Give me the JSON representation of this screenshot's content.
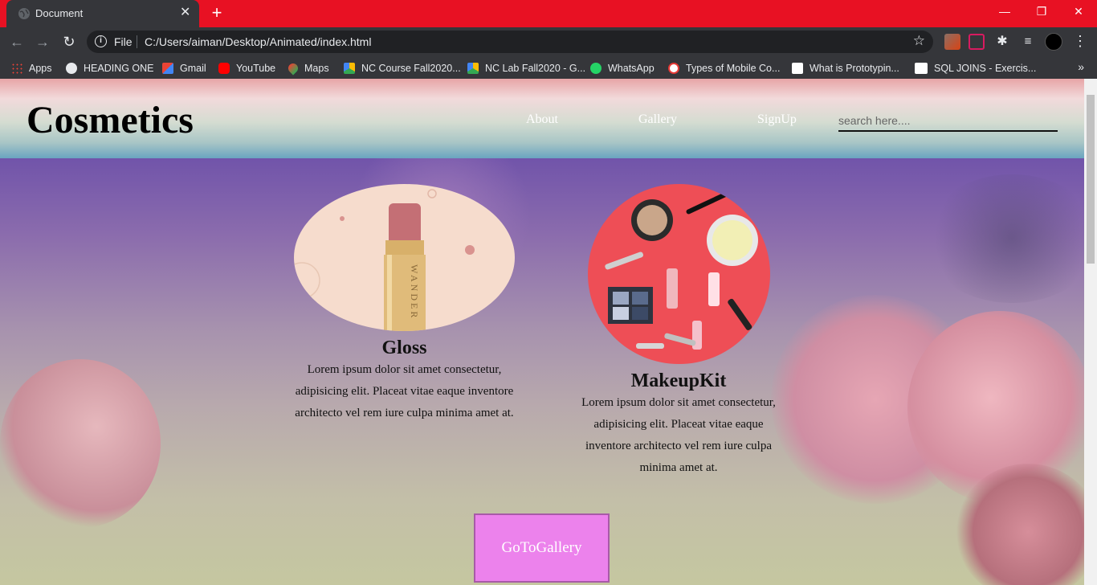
{
  "browser": {
    "tab_title": "Document",
    "new_tab": "+",
    "scheme": "File",
    "url": "C:/Users/aiman/Desktop/Animated/index.html",
    "window_controls": {
      "minimize": "—",
      "restore": "❐",
      "close": "✕"
    },
    "bookmarks": [
      {
        "label": "Apps",
        "icon": "apps-grid-icon",
        "color": "#ea4335"
      },
      {
        "label": "HEADING ONE",
        "icon": "globe-icon",
        "color": "#e8eaed"
      },
      {
        "label": "Gmail",
        "icon": "gmail-icon",
        "color": "#d93025"
      },
      {
        "label": "YouTube",
        "icon": "youtube-icon",
        "color": "#ff0000"
      },
      {
        "label": "Maps",
        "icon": "maps-pin-icon",
        "color": "#34a853"
      },
      {
        "label": "NC Course Fall2020...",
        "icon": "drive-icon",
        "color": "#fbbc04"
      },
      {
        "label": "NC Lab Fall2020 - G...",
        "icon": "drive-icon",
        "color": "#fbbc04"
      },
      {
        "label": "WhatsApp",
        "icon": "whatsapp-icon",
        "color": "#25d366"
      },
      {
        "label": "Types of Mobile Co...",
        "icon": "page-icon",
        "color": "#e53935"
      },
      {
        "label": "What is Prototypin...",
        "icon": "page-icon",
        "color": "#ffffff"
      },
      {
        "label": "SQL JOINS - Exercis...",
        "icon": "w3-icon",
        "color": "#ffffff"
      }
    ],
    "bookmarks_more": "»"
  },
  "site": {
    "brand": "Cosmetics",
    "nav": [
      "About",
      "Gallery",
      "SignUp"
    ],
    "search_placeholder": "search here....",
    "products": [
      {
        "name": "Gloss",
        "description": "Lorem ipsum dolor sit amet consectetur, adipisicing elit. Placeat vitae eaque inventore architecto vel rem iure culpa minima amet at."
      },
      {
        "name": "MakeupKit",
        "description": "Lorem ipsum dolor sit amet consectetur, adipisicing elit. Placeat vitae eaque inventore architecto vel rem iure culpa minima amet at."
      }
    ],
    "cta": "GoToGallery"
  }
}
